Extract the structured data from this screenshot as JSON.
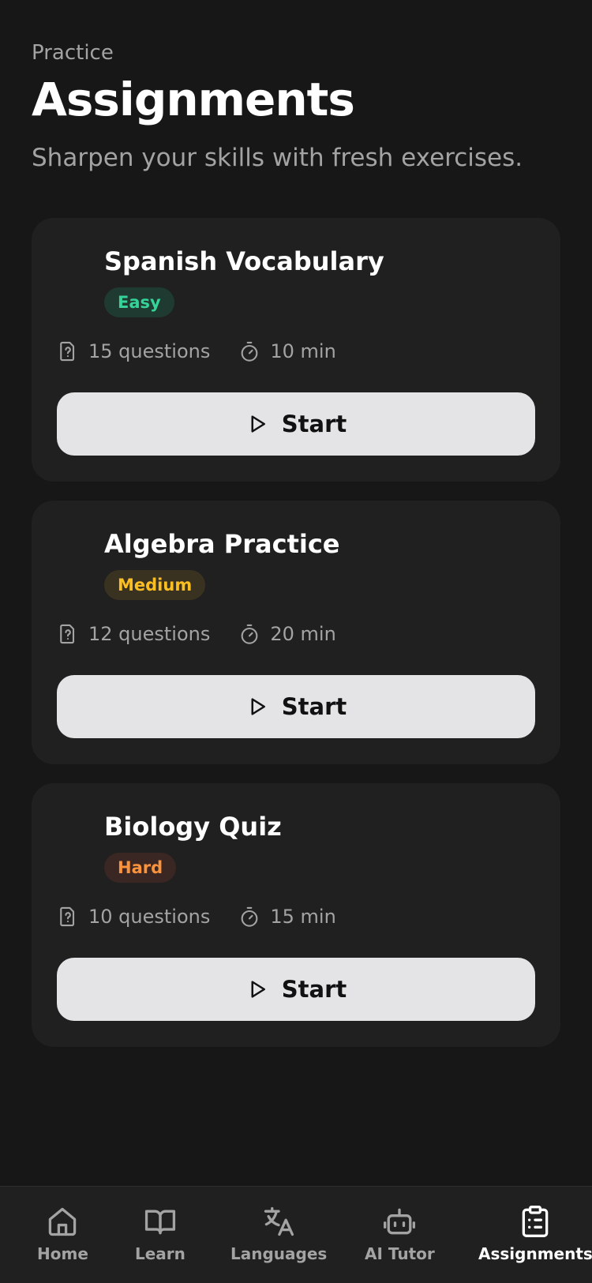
{
  "header": {
    "eyebrow": "Practice",
    "title": "Assignments",
    "subtitle": "Sharpen your skills with fresh exercises."
  },
  "assignments": [
    {
      "title": "Spanish Vocabulary",
      "difficulty": "Easy",
      "difficulty_color": "#34d399",
      "difficulty_bg": "#1f3a30",
      "questions": "15 questions",
      "duration": "10 min",
      "action_label": "Start"
    },
    {
      "title": "Algebra Practice",
      "difficulty": "Medium",
      "difficulty_color": "#fbbf24",
      "difficulty_bg": "#3a3220",
      "questions": "12 questions",
      "duration": "20 min",
      "action_label": "Start"
    },
    {
      "title": "Biology Quiz",
      "difficulty": "Hard",
      "difficulty_color": "#fb923c",
      "difficulty_bg": "#3a2723",
      "questions": "10 questions",
      "duration": "15 min",
      "action_label": "Start"
    }
  ],
  "icons": {
    "questions": "question-file-icon",
    "duration": "stopwatch-icon",
    "start": "play-icon"
  },
  "nav": {
    "items": [
      {
        "label": "Home",
        "icon": "home-icon",
        "active": false
      },
      {
        "label": "Learn",
        "icon": "book-open-icon",
        "active": false
      },
      {
        "label": "Languages",
        "icon": "translate-icon",
        "active": false
      },
      {
        "label": "AI Tutor",
        "icon": "bot-icon",
        "active": false
      },
      {
        "label": "Assignments",
        "icon": "clipboard-list-icon",
        "active": true
      }
    ]
  },
  "colors": {
    "background": "#171717",
    "card": "#202021",
    "button": "#e4e4e7",
    "muted_text": "#a3a3a3"
  }
}
